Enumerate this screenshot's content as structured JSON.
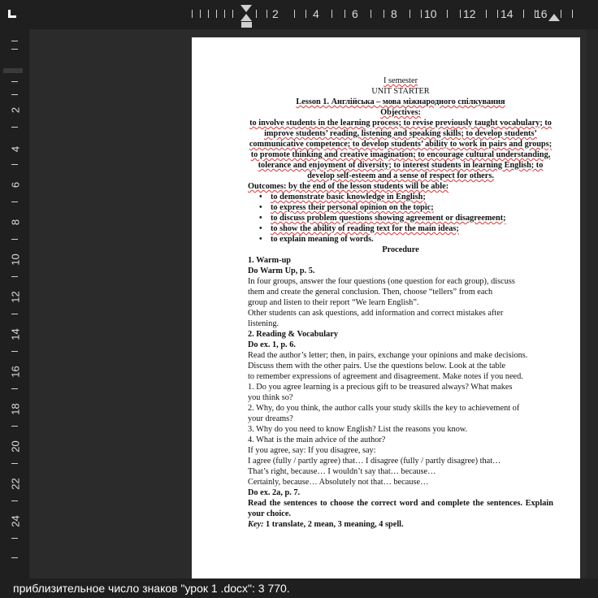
{
  "ruler": {
    "h_labels": [
      "2",
      "4",
      "6",
      "8",
      "10",
      "12",
      "14",
      "16"
    ],
    "v_labels": [
      "2",
      "4",
      "6",
      "8",
      "10",
      "12",
      "14",
      "16",
      "18",
      "20",
      "22",
      "24"
    ]
  },
  "doc": {
    "semester": "I semester",
    "unit": "UNIT STARTER",
    "lesson": "Lesson 1. Англійська – мова міжнародного спілкування",
    "objectives_head": "Objectives:",
    "objectives_text": "to involve students in the learning process; to revise previously taught vocabulary; to improve students’ reading, listening and speaking skills; to develop students’ communicative competence; to develop students’ ability to work in pairs and groups; to promote thinking and creative imagination; to encourage cultural understanding, tolerance and enjoyment of diversity; to interest students in learning English; to develop self-esteem and a sense of respect for others.",
    "outcomes": "Outcomes: by the end of the lesson students will be able:",
    "bullets": [
      "to demonstrate basic knowledge in English;",
      "to express their personal opinion on the topic;",
      "to discuss problem questions showing agreement or disagreement;",
      "to show the ability of reading text for the main ideas;",
      "to explain meaning of words."
    ],
    "procedure": "Procedure",
    "warmup_head": "1. Warm-up",
    "warmup_do": "Do Warm Up, p. 5.",
    "warmup_lines": [
      "In four groups, answer the four questions (one question for each group), discuss",
      "them and create the general conclusion. Then, choose “tellers” from each",
      "group and listen to their report “We learn English”.",
      "Other students can ask questions, add information and correct mistakes after",
      "listening."
    ],
    "reading_head": "2. Reading & Vocabulary",
    "reading_do": "Do ex. 1, p. 6.",
    "reading_lines": [
      "Read the author’s letter; then, in pairs, exchange your opinions and make decisions.",
      "Discuss them with the other pairs. Use the questions below. Look at the table",
      "to remember expressions of agreement and disagreement. Make notes if you need.",
      "1. Do you agree learning is a precious gift to be treasured always? What makes",
      "you think so?",
      "2. Why, do you think, the author calls your study skills the key to achievement of",
      "your dreams?",
      "3. Why do you need to know English? List the reasons you know.",
      "4. What is the main advice of the author?",
      "If you agree, say: If you disagree, say:",
      "I agree (fully / partly agree) that… I disagree (fully / partly disagree) that…",
      "That’s right, because… I wouldn’t say that… because…",
      "Certainly, because… Absolutely not that… because…"
    ],
    "ex2_do": "Do ex. 2a, p. 7.",
    "ex2_text": "Read the sentences to choose the correct word and complete the sentences. Explain your choice.",
    "key_label": "Key:",
    "key_text": " 1 translate, 2 mean, 3 meaning, 4 spell."
  },
  "status": {
    "text": "приблизительное число знаков \"урок 1 .docx\": 3 770."
  }
}
